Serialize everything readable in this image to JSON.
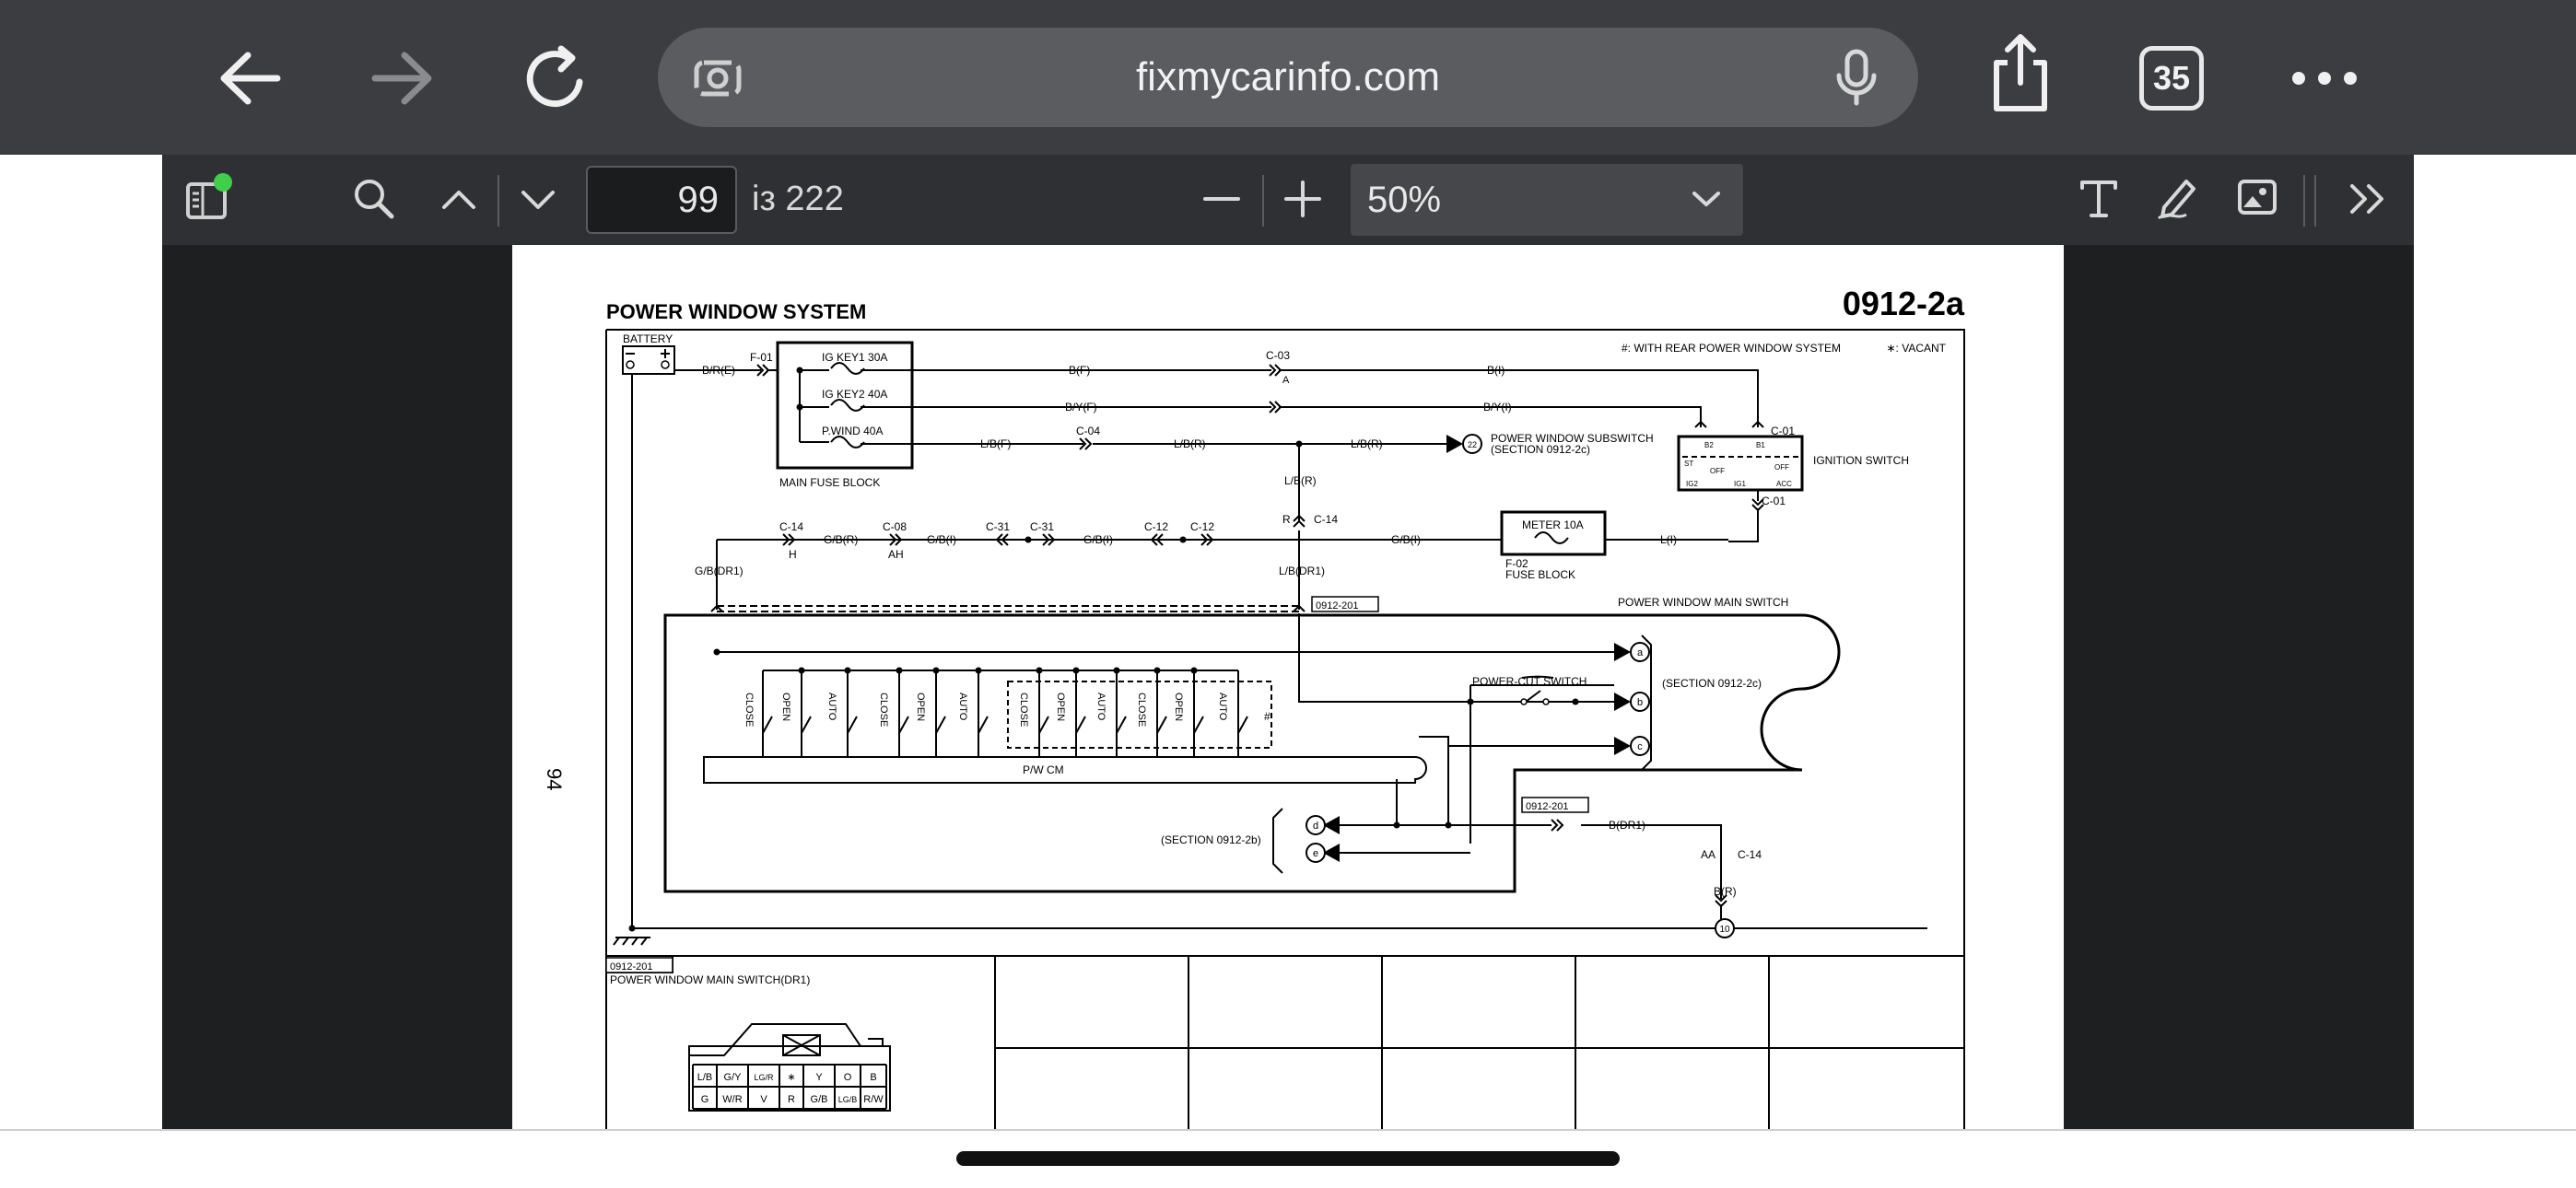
{
  "browser": {
    "url": "fixmycarinfo.com",
    "tabs_count": "35",
    "icons": [
      "back-arrow-icon",
      "forward-arrow-icon",
      "reload-icon",
      "page-settings-icon",
      "microphone-icon",
      "share-icon",
      "tabs-icon",
      "more-icon"
    ]
  },
  "viewer": {
    "page_number": "99",
    "page_total": "із 222",
    "zoom": "50%",
    "icons": [
      "sidebar-icon",
      "search-icon",
      "prev-page-icon",
      "next-page-icon",
      "zoom-out-icon",
      "zoom-in-icon",
      "dropdown-icon",
      "text-tool-icon",
      "draw-tool-icon",
      "image-tool-icon",
      "more-tools-icon"
    ]
  },
  "document": {
    "page_side_number": "94",
    "title": "POWER WINDOW SYSTEM",
    "code": "0912-2a",
    "note_rear": "#: WITH REAR POWER WINDOW SYSTEM",
    "note_vacant": "∗: VACANT",
    "battery": "BATTERY",
    "fuse_block_main": "MAIN FUSE BLOCK",
    "fuse1": "IG KEY1 30A",
    "fuse2": "IG KEY2 40A",
    "fuse3": "P.WIND 40A",
    "f01": "F-01",
    "wire_bre": "B/R(E)",
    "wire_bf": "B(F)",
    "wire_byf": "B/Y(F)",
    "wire_lbf": "L/B(F)",
    "wire_bi": "B(I)",
    "wire_byi": "B/Y(I)",
    "wire_lbr1": "L/B(R)",
    "wire_lbr2": "L/B(R)",
    "wire_lbr3": "L/B(R)",
    "c03": "C-03",
    "c03_a": "A",
    "c04": "C-04",
    "c01_top": "C-01",
    "c01_bottom": "C-01",
    "ignition_switch": "IGNITION SWITCH",
    "pw_subswitch": "POWER WINDOW SUBSWITCH",
    "pw_subswitch_section": "(SECTION 0912-2c)",
    "connector_22": "22",
    "c14_left": "C-14",
    "c14_h": "H",
    "c08": "C-08",
    "c08_ah": "AH",
    "c31_a": "C-31",
    "c31_b": "C-31",
    "c12_a": "C-12",
    "c12_b": "C-12",
    "c14_mid": "C-14",
    "c14_r": "R",
    "wire_gbr": "G/B(R)",
    "wire_gbl1": "G/B(I)",
    "wire_gbl2": "G/B(I)",
    "wire_gbl3": "G/B(I)",
    "wire_gbdr1": "G/B(DR1)",
    "wire_lbdr1": "L/B(DR1)",
    "wire_li": "L(I)",
    "meter_fuse": "METER 10A",
    "f02": "F-02",
    "fuse_block": "FUSE BLOCK",
    "ref_0912_201_a": "0912-201",
    "ref_0912_201_b": "0912-201",
    "ref_0912_201_c": "0912-201",
    "pw_main_switch": "POWER WINDOW MAIN SWITCH",
    "power_cut_switch": "POWER-CUT SWITCH",
    "section_2c": "(SECTION 0912-2c)",
    "section_2b": "(SECTION 0912-2b)",
    "pw_cm": "P/W CM",
    "term_a": "a",
    "term_b": "b",
    "term_c": "c",
    "term_d": "d",
    "term_e": "e",
    "switch_labels": [
      "CLOSE",
      "OPEN",
      "AUTO",
      "CLOSE",
      "OPEN",
      "AUTO",
      "CLOSE",
      "OPEN",
      "AUTO",
      "CLOSE",
      "OPEN",
      "AUTO"
    ],
    "hash_mark": "#",
    "wire_bdr1": "B(DR1)",
    "wire_br": "B(R)",
    "c14_aa": "AA",
    "c14_bottom": "C-14",
    "ground_10": "10",
    "main_switch_dr1": "POWER WINDOW MAIN SWITCH(DR1)",
    "ig_labels": {
      "st": "ST",
      "b2": "B2",
      "b1": "B1",
      "off1": "OFF",
      "off2": "OFF",
      "acc": "ACC",
      "ig2": "IG2",
      "ig1": "IG1"
    },
    "connector_row1": [
      "L/B",
      "G/Y",
      "LG/R",
      "∗",
      "Y",
      "O",
      "B"
    ],
    "connector_row2": [
      "G",
      "W/R",
      "V",
      "R",
      "G/B",
      "LG/B",
      "R/W"
    ]
  }
}
